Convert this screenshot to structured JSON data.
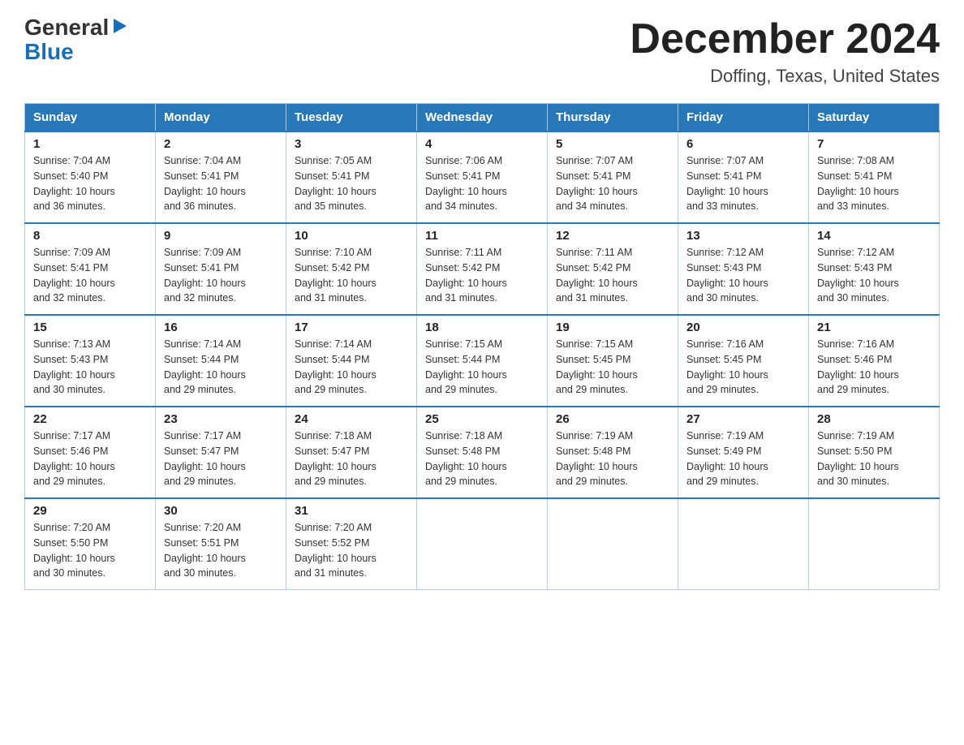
{
  "logo": {
    "general": "General",
    "blue": "Blue",
    "arrow": "▶"
  },
  "title": "December 2024",
  "location": "Doffing, Texas, United States",
  "weekdays": [
    "Sunday",
    "Monday",
    "Tuesday",
    "Wednesday",
    "Thursday",
    "Friday",
    "Saturday"
  ],
  "weeks": [
    [
      {
        "day": "1",
        "info": "Sunrise: 7:04 AM\nSunset: 5:40 PM\nDaylight: 10 hours\nand 36 minutes."
      },
      {
        "day": "2",
        "info": "Sunrise: 7:04 AM\nSunset: 5:41 PM\nDaylight: 10 hours\nand 36 minutes."
      },
      {
        "day": "3",
        "info": "Sunrise: 7:05 AM\nSunset: 5:41 PM\nDaylight: 10 hours\nand 35 minutes."
      },
      {
        "day": "4",
        "info": "Sunrise: 7:06 AM\nSunset: 5:41 PM\nDaylight: 10 hours\nand 34 minutes."
      },
      {
        "day": "5",
        "info": "Sunrise: 7:07 AM\nSunset: 5:41 PM\nDaylight: 10 hours\nand 34 minutes."
      },
      {
        "day": "6",
        "info": "Sunrise: 7:07 AM\nSunset: 5:41 PM\nDaylight: 10 hours\nand 33 minutes."
      },
      {
        "day": "7",
        "info": "Sunrise: 7:08 AM\nSunset: 5:41 PM\nDaylight: 10 hours\nand 33 minutes."
      }
    ],
    [
      {
        "day": "8",
        "info": "Sunrise: 7:09 AM\nSunset: 5:41 PM\nDaylight: 10 hours\nand 32 minutes."
      },
      {
        "day": "9",
        "info": "Sunrise: 7:09 AM\nSunset: 5:41 PM\nDaylight: 10 hours\nand 32 minutes."
      },
      {
        "day": "10",
        "info": "Sunrise: 7:10 AM\nSunset: 5:42 PM\nDaylight: 10 hours\nand 31 minutes."
      },
      {
        "day": "11",
        "info": "Sunrise: 7:11 AM\nSunset: 5:42 PM\nDaylight: 10 hours\nand 31 minutes."
      },
      {
        "day": "12",
        "info": "Sunrise: 7:11 AM\nSunset: 5:42 PM\nDaylight: 10 hours\nand 31 minutes."
      },
      {
        "day": "13",
        "info": "Sunrise: 7:12 AM\nSunset: 5:43 PM\nDaylight: 10 hours\nand 30 minutes."
      },
      {
        "day": "14",
        "info": "Sunrise: 7:12 AM\nSunset: 5:43 PM\nDaylight: 10 hours\nand 30 minutes."
      }
    ],
    [
      {
        "day": "15",
        "info": "Sunrise: 7:13 AM\nSunset: 5:43 PM\nDaylight: 10 hours\nand 30 minutes."
      },
      {
        "day": "16",
        "info": "Sunrise: 7:14 AM\nSunset: 5:44 PM\nDaylight: 10 hours\nand 29 minutes."
      },
      {
        "day": "17",
        "info": "Sunrise: 7:14 AM\nSunset: 5:44 PM\nDaylight: 10 hours\nand 29 minutes."
      },
      {
        "day": "18",
        "info": "Sunrise: 7:15 AM\nSunset: 5:44 PM\nDaylight: 10 hours\nand 29 minutes."
      },
      {
        "day": "19",
        "info": "Sunrise: 7:15 AM\nSunset: 5:45 PM\nDaylight: 10 hours\nand 29 minutes."
      },
      {
        "day": "20",
        "info": "Sunrise: 7:16 AM\nSunset: 5:45 PM\nDaylight: 10 hours\nand 29 minutes."
      },
      {
        "day": "21",
        "info": "Sunrise: 7:16 AM\nSunset: 5:46 PM\nDaylight: 10 hours\nand 29 minutes."
      }
    ],
    [
      {
        "day": "22",
        "info": "Sunrise: 7:17 AM\nSunset: 5:46 PM\nDaylight: 10 hours\nand 29 minutes."
      },
      {
        "day": "23",
        "info": "Sunrise: 7:17 AM\nSunset: 5:47 PM\nDaylight: 10 hours\nand 29 minutes."
      },
      {
        "day": "24",
        "info": "Sunrise: 7:18 AM\nSunset: 5:47 PM\nDaylight: 10 hours\nand 29 minutes."
      },
      {
        "day": "25",
        "info": "Sunrise: 7:18 AM\nSunset: 5:48 PM\nDaylight: 10 hours\nand 29 minutes."
      },
      {
        "day": "26",
        "info": "Sunrise: 7:19 AM\nSunset: 5:48 PM\nDaylight: 10 hours\nand 29 minutes."
      },
      {
        "day": "27",
        "info": "Sunrise: 7:19 AM\nSunset: 5:49 PM\nDaylight: 10 hours\nand 29 minutes."
      },
      {
        "day": "28",
        "info": "Sunrise: 7:19 AM\nSunset: 5:50 PM\nDaylight: 10 hours\nand 30 minutes."
      }
    ],
    [
      {
        "day": "29",
        "info": "Sunrise: 7:20 AM\nSunset: 5:50 PM\nDaylight: 10 hours\nand 30 minutes."
      },
      {
        "day": "30",
        "info": "Sunrise: 7:20 AM\nSunset: 5:51 PM\nDaylight: 10 hours\nand 30 minutes."
      },
      {
        "day": "31",
        "info": "Sunrise: 7:20 AM\nSunset: 5:52 PM\nDaylight: 10 hours\nand 31 minutes."
      },
      null,
      null,
      null,
      null
    ]
  ]
}
